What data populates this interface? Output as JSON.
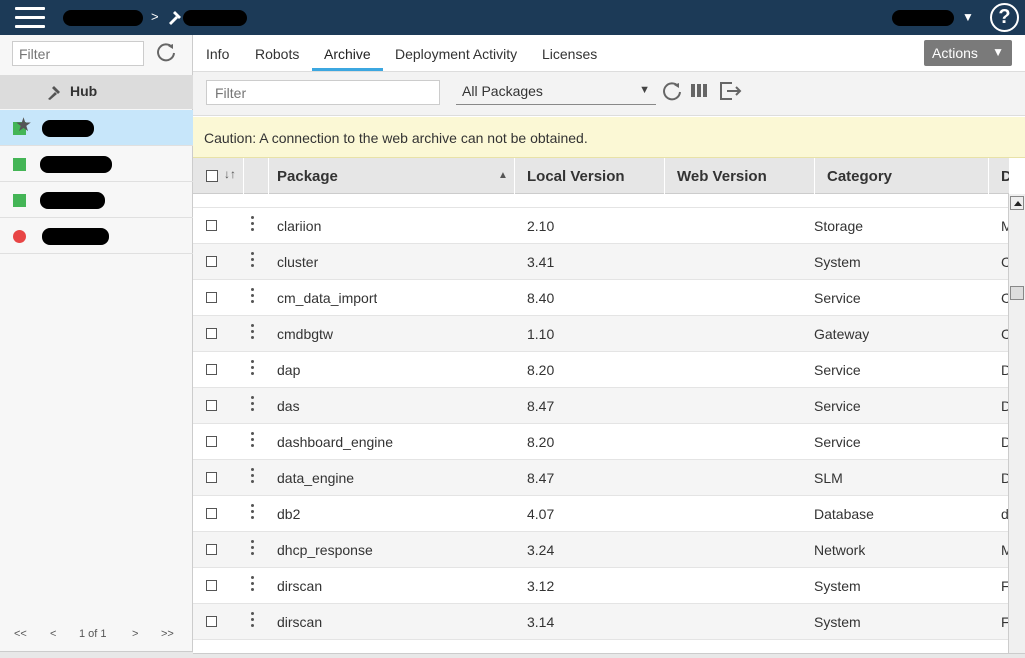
{
  "sidebar": {
    "filter_placeholder": "Filter",
    "hub_label": "Hub",
    "robots": [
      {
        "status": "green",
        "status_color": "#44b556",
        "selected": true,
        "star": true
      },
      {
        "status": "green",
        "status_color": "#44b556",
        "selected": false,
        "star": false
      },
      {
        "status": "green",
        "status_color": "#44b556",
        "selected": false,
        "star": false
      },
      {
        "status": "red",
        "status_color": "#e84545",
        "selected": false,
        "star": false
      }
    ],
    "pager": {
      "first": "<<",
      "prev": "<",
      "page_info": "1 of 1",
      "next": ">",
      "last": ">>"
    }
  },
  "tabs": [
    {
      "label": "Info",
      "active": false
    },
    {
      "label": "Robots",
      "active": false
    },
    {
      "label": "Archive",
      "active": true
    },
    {
      "label": "Deployment Activity",
      "active": false
    },
    {
      "label": "Licenses",
      "active": false
    }
  ],
  "actions_label": "Actions",
  "toolbar": {
    "filter_placeholder": "Filter",
    "package_select": "All Packages"
  },
  "caution_text": "Caution: A connection to the web archive can not be obtained.",
  "table": {
    "columns": {
      "package": "Package",
      "local_version": "Local Version",
      "web_version": "Web Version",
      "category": "Category",
      "description": "Des"
    },
    "rows": [
      {
        "package": "clariion",
        "local_version": "2.10",
        "web_version": "",
        "category": "Storage",
        "desc": "M"
      },
      {
        "package": "cluster",
        "local_version": "3.41",
        "web_version": "",
        "category": "System",
        "desc": "C"
      },
      {
        "package": "cm_data_import",
        "local_version": "8.40",
        "web_version": "",
        "category": "Service",
        "desc": "C"
      },
      {
        "package": "cmdbgtw",
        "local_version": "1.10",
        "web_version": "",
        "category": "Gateway",
        "desc": "C"
      },
      {
        "package": "dap",
        "local_version": "8.20",
        "web_version": "",
        "category": "Service",
        "desc": "D"
      },
      {
        "package": "das",
        "local_version": "8.47",
        "web_version": "",
        "category": "Service",
        "desc": "D"
      },
      {
        "package": "dashboard_engine",
        "local_version": "8.20",
        "web_version": "",
        "category": "Service",
        "desc": "D"
      },
      {
        "package": "data_engine",
        "local_version": "8.47",
        "web_version": "",
        "category": "SLM",
        "desc": "D"
      },
      {
        "package": "db2",
        "local_version": "4.07",
        "web_version": "",
        "category": "Database",
        "desc": "d"
      },
      {
        "package": "dhcp_response",
        "local_version": "3.24",
        "web_version": "",
        "category": "Network",
        "desc": "M"
      },
      {
        "package": "dirscan",
        "local_version": "3.12",
        "web_version": "",
        "category": "System",
        "desc": "F"
      },
      {
        "package": "dirscan",
        "local_version": "3.14",
        "web_version": "",
        "category": "System",
        "desc": "F"
      }
    ]
  },
  "icons": {
    "menu": "hamburger-icon",
    "help": "help-icon",
    "refresh": "refresh-icon",
    "columns": "columns-icon",
    "export": "export-icon",
    "robot": "robot-icon",
    "star": "star-icon"
  },
  "colors": {
    "header_bg": "#1c3a57",
    "tab_active_underline": "#3ca7e0",
    "caution_bg": "#fbf8d5",
    "selected_row": "#c7e6fa"
  }
}
